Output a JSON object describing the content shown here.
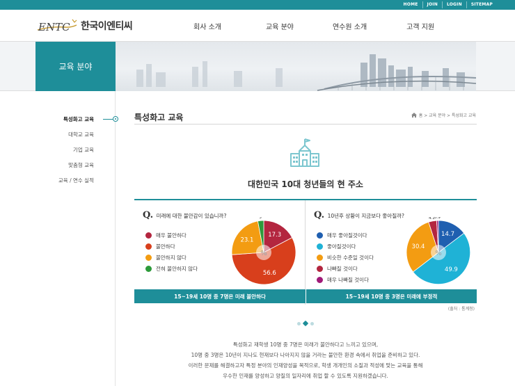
{
  "topbar": {
    "links": [
      "HOME",
      "JOIN",
      "LOGIN",
      "SITEMAP"
    ]
  },
  "header": {
    "logo_mark": "ENTC",
    "logo_text": "한국이엔티씨",
    "nav": [
      "회사 소개",
      "교육 분야",
      "연수원 소개",
      "고객 지원"
    ]
  },
  "banner": {
    "title": "교육 분야"
  },
  "sidebar": {
    "items": [
      {
        "label": "특성화고 교육",
        "active": true
      },
      {
        "label": "대학교 교육",
        "active": false
      },
      {
        "label": "기업 교육",
        "active": false
      },
      {
        "label": "맞춤형 교육",
        "active": false
      },
      {
        "label": "교육 / 연수 실적",
        "active": false
      }
    ]
  },
  "page": {
    "title": "특성화고 교육",
    "breadcrumb": "홈 > 교육 분야 > 특성화고 교육",
    "headline": "대한민국 10대 청년들의 현 주소"
  },
  "survey": {
    "left": {
      "question_mark": "Q.",
      "question": "미래에 대한 불안감이 있습니까?",
      "result": "15~19세 10명 중 7명은 미래 불안하다"
    },
    "right": {
      "question_mark": "Q.",
      "question": "10년후 상황이 지금보다 좋아질까?",
      "result": "15~19세 10명 중 3명은 미래에 부정적"
    },
    "center_label": "%",
    "source": "(출처 : 통계청)"
  },
  "chart_data": [
    {
      "type": "pie",
      "categories": [
        "매우 불안하다",
        "불안하다",
        "불안하지 않다",
        "전혀 불안하지 않다"
      ],
      "values": [
        17.3,
        56.6,
        23.1,
        3
      ],
      "colors": [
        "#b3263f",
        "#d83f1c",
        "#f39c12",
        "#2d9a3a"
      ]
    },
    {
      "type": "pie",
      "categories": [
        "매우 좋아질것이다",
        "좋아질것이다",
        "비슷한 수준일 것이다",
        "나빠질 것이다",
        "매우 나빠질 것이다"
      ],
      "values": [
        14.7,
        49.9,
        30.4,
        4.1,
        0.9
      ],
      "colors": [
        "#1f5fb0",
        "#1fb2d6",
        "#f39c12",
        "#b3263f",
        "#a01a78"
      ]
    }
  ],
  "body_text": [
    "특성화고 재학생 10명 중 7명은 미래가 불안하다고 느끼고 있으며,",
    "10명 중 3명은 10년이 지나도 현재보다 나아지지 않을 거라는 불안한 환경 속에서 취업을 준비하고 있다.",
    "이러한 문제를 해결하고자 특정 분야의 인재양성을 목적으로, 학생 개개인의 소질과 적성에 맞는 교육을 통해",
    "우수한 인재를 양성하고 양질의 일자리에 취업 할 수 있도록 지원하겠습니다."
  ]
}
